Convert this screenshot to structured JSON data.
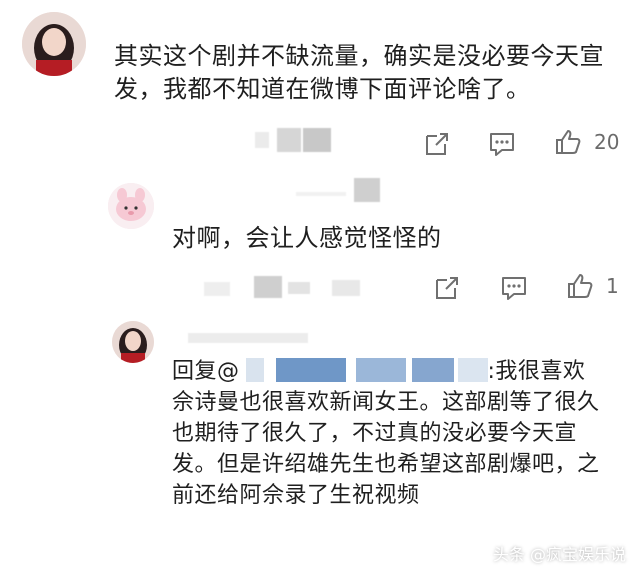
{
  "comments": [
    {
      "text": "其实这个剧并不缺流量，确实是没必要今天宣发，我都不知道在微博下面评论啥了。",
      "likes": "20"
    },
    {
      "text": "对啊，会让人感觉怪怪的",
      "likes": "1"
    },
    {
      "reply_prefix": "回复@",
      "reply_body": ":我很喜欢佘诗曼也很喜欢新闻女王。这部剧等了很久也期待了很久了，不过真的没必要今天宣发。但是许绍雄先生也希望这部剧爆吧，之前还给阿佘录了生祝视频"
    }
  ],
  "footer": {
    "brand": "头条 @疯宝娱乐说"
  },
  "icons": {
    "share": "share-icon",
    "comment": "comment-icon",
    "like": "thumbs-up-icon"
  }
}
